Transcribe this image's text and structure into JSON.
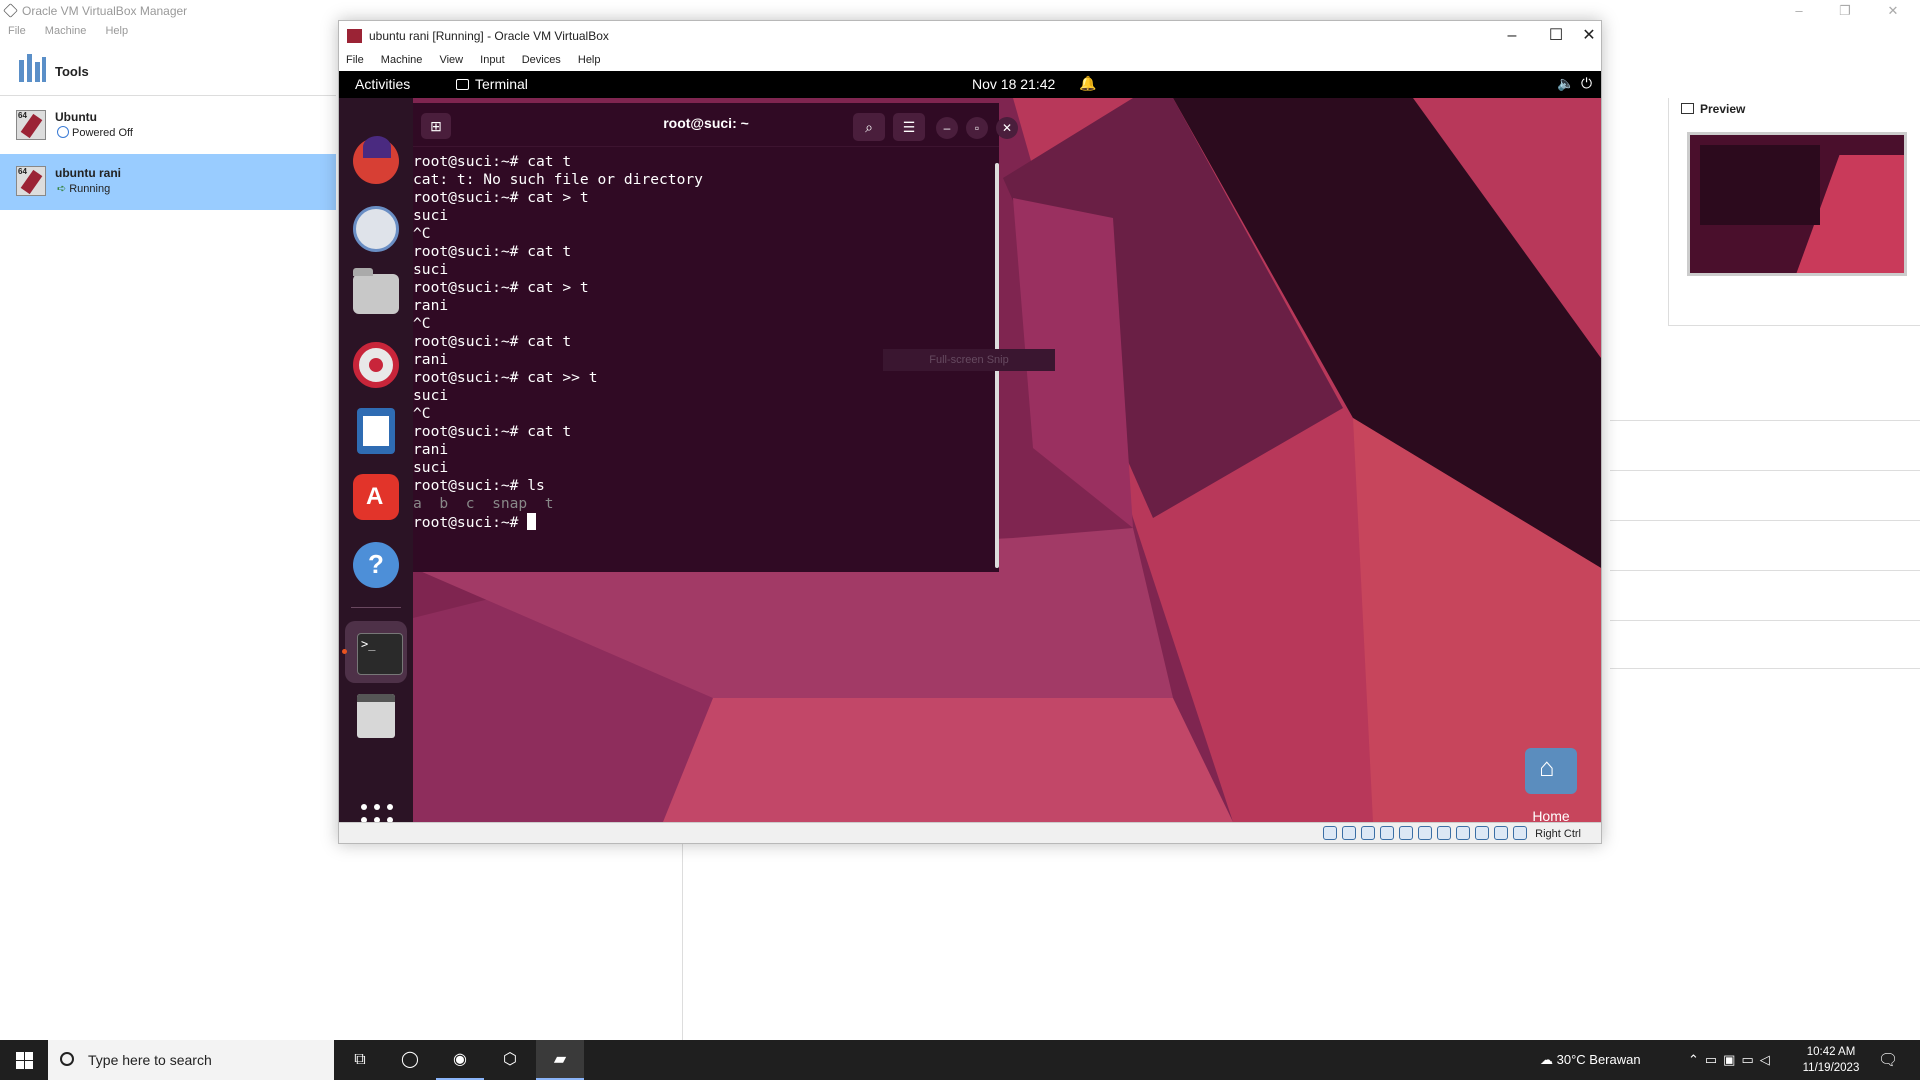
{
  "manager": {
    "title": "Oracle VM VirtualBox Manager",
    "menu": [
      "File",
      "Machine",
      "Help"
    ],
    "tools_label": "Tools",
    "vms": [
      {
        "name": "Ubuntu",
        "state": "Powered Off"
      },
      {
        "name": "ubuntu rani",
        "state": "Running"
      }
    ],
    "preview_label": "Preview",
    "selected_vm_color": "#99ccff"
  },
  "vm_window": {
    "title": "ubuntu rani [Running] - Oracle VM VirtualBox",
    "menu": [
      "File",
      "Machine",
      "View",
      "Input",
      "Devices",
      "Help"
    ],
    "status_hostkey": "Right Ctrl"
  },
  "guest": {
    "topbar": {
      "activities": "Activities",
      "app": "Terminal",
      "clock": "Nov 18  21:42"
    },
    "terminal": {
      "title": "root@suci: ~",
      "lines": [
        "root@suci:~# cat t",
        "cat: t: No such file or directory",
        "root@suci:~# cat > t",
        "suci",
        "^C",
        "root@suci:~# cat t",
        "suci",
        "root@suci:~# cat > t",
        "rani",
        "^C",
        "root@suci:~# cat t",
        "rani",
        "root@suci:~# cat >> t",
        "suci",
        "^C",
        "root@suci:~# cat t",
        "rani",
        "suci",
        "root@suci:~# ls"
      ],
      "ls_output": "a  b  c  snap  t",
      "prompt": "root@suci:~# "
    },
    "snip_label": "Full-screen Snip",
    "desktop_home": "Home",
    "colors": {
      "terminal_bg": "#300a24",
      "wallpaper": "#7f2550"
    }
  },
  "taskbar": {
    "search_placeholder": "Type here to search",
    "weather": "30°C  Berawan",
    "time": "10:42 AM",
    "date": "11/19/2023"
  }
}
